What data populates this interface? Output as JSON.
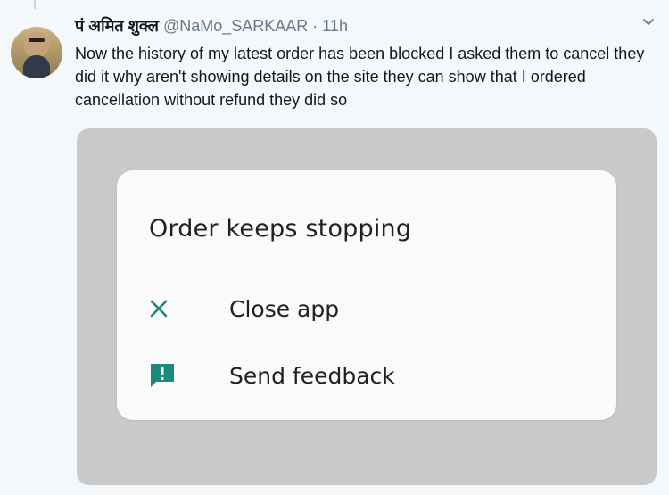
{
  "tweet": {
    "display_name": "पं अमित शुक्ल",
    "handle": "@NaMo_SARKAAR",
    "separator": "·",
    "time": "11h",
    "text": "Now the history of my latest order has been blocked I asked them to cancel they did it why aren't showing details on the site they can show that I ordered cancellation without refund they did so"
  },
  "dialog": {
    "title": "Order keeps stopping",
    "options": [
      {
        "label": "Close app",
        "icon": "close-icon"
      },
      {
        "label": "Send feedback",
        "icon": "feedback-icon"
      }
    ]
  },
  "colors": {
    "accent_teal": "#1a8a7a",
    "handle_gray": "#657786",
    "media_bg": "#c9c9c9"
  }
}
